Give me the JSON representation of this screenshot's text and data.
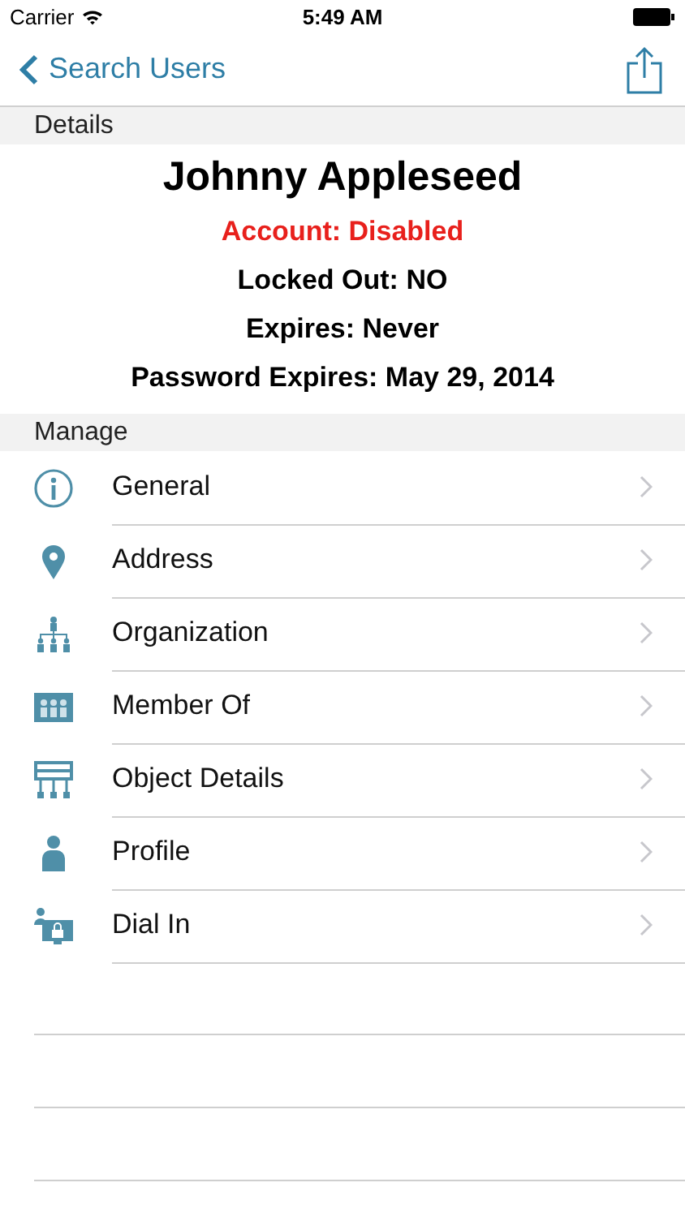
{
  "status_bar": {
    "carrier": "Carrier",
    "time": "5:49 AM"
  },
  "nav": {
    "back": "Search Users"
  },
  "details": {
    "header": "Details",
    "name": "Johnny Appleseed",
    "lines": [
      {
        "text": "Account: Disabled",
        "alert": true
      },
      {
        "text": "Locked Out: NO",
        "alert": false
      },
      {
        "text": "Expires: Never",
        "alert": false
      },
      {
        "text": "Password Expires: May 29, 2014",
        "alert": false
      }
    ]
  },
  "manage": {
    "header": "Manage",
    "items": [
      {
        "kind": "info",
        "label": "General"
      },
      {
        "kind": "pin",
        "label": "Address"
      },
      {
        "kind": "org",
        "label": "Organization"
      },
      {
        "kind": "group",
        "label": "Member Of"
      },
      {
        "kind": "tree",
        "label": "Object Details"
      },
      {
        "kind": "person",
        "label": "Profile"
      },
      {
        "kind": "dialin",
        "label": "Dial In"
      }
    ]
  }
}
